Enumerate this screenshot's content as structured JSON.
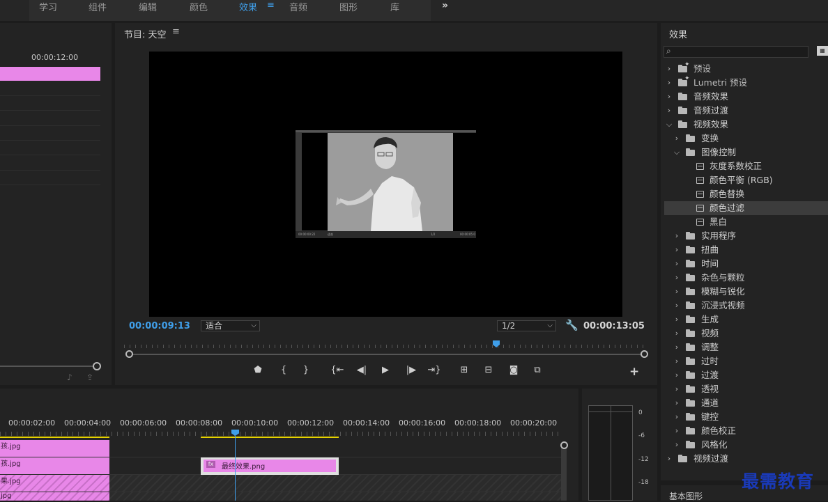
{
  "workspace_tabs": {
    "items": [
      {
        "label": "学习"
      },
      {
        "label": "组件"
      },
      {
        "label": "编辑"
      },
      {
        "label": "颜色"
      },
      {
        "label": "效果"
      },
      {
        "label": "音频"
      },
      {
        "label": "图形"
      },
      {
        "label": "库"
      }
    ],
    "active": "效果",
    "more_label": "»"
  },
  "left_panel": {
    "timecode": "00:00:12:00"
  },
  "program_monitor": {
    "title": "节目: 天空",
    "menu_icon": "≡",
    "current_timecode": "00:00:09:13",
    "fit_value": "适合",
    "resolution_value": "1/2",
    "duration": "00:00:13:05",
    "inner_thumb": {
      "left_time": "00:00:00:22",
      "fit": "适合",
      "res": "1/2",
      "right_time": "00:00:05:0"
    }
  },
  "effects_panel": {
    "title": "效果",
    "items": [
      {
        "label": "预设",
        "level": 0,
        "expanded": false,
        "type": "preset-folder"
      },
      {
        "label": "Lumetri 预设",
        "level": 0,
        "expanded": false,
        "type": "preset-folder"
      },
      {
        "label": "音频效果",
        "level": 0,
        "expanded": false,
        "type": "folder"
      },
      {
        "label": "音频过渡",
        "level": 0,
        "expanded": false,
        "type": "folder"
      },
      {
        "label": "视频效果",
        "level": 0,
        "expanded": true,
        "type": "folder"
      },
      {
        "label": "变换",
        "level": 1,
        "expanded": false,
        "type": "folder"
      },
      {
        "label": "图像控制",
        "level": 1,
        "expanded": true,
        "type": "folder"
      },
      {
        "label": "灰度系数校正",
        "level": 2,
        "type": "effect"
      },
      {
        "label": "颜色平衡 (RGB)",
        "level": 2,
        "type": "effect"
      },
      {
        "label": "颜色替换",
        "level": 2,
        "type": "effect"
      },
      {
        "label": "颜色过滤",
        "level": 2,
        "type": "effect",
        "selected": true
      },
      {
        "label": "黑白",
        "level": 2,
        "type": "effect"
      },
      {
        "label": "实用程序",
        "level": 1,
        "expanded": false,
        "type": "folder"
      },
      {
        "label": "扭曲",
        "level": 1,
        "expanded": false,
        "type": "folder"
      },
      {
        "label": "时间",
        "level": 1,
        "expanded": false,
        "type": "folder"
      },
      {
        "label": "杂色与颗粒",
        "level": 1,
        "expanded": false,
        "type": "folder"
      },
      {
        "label": "模糊与锐化",
        "level": 1,
        "expanded": false,
        "type": "folder"
      },
      {
        "label": "沉浸式视频",
        "level": 1,
        "expanded": false,
        "type": "folder"
      },
      {
        "label": "生成",
        "level": 1,
        "expanded": false,
        "type": "folder"
      },
      {
        "label": "视频",
        "level": 1,
        "expanded": false,
        "type": "folder"
      },
      {
        "label": "调整",
        "level": 1,
        "expanded": false,
        "type": "folder"
      },
      {
        "label": "过时",
        "level": 1,
        "expanded": false,
        "type": "folder"
      },
      {
        "label": "过渡",
        "level": 1,
        "expanded": false,
        "type": "folder"
      },
      {
        "label": "透视",
        "level": 1,
        "expanded": false,
        "type": "folder"
      },
      {
        "label": "通道",
        "level": 1,
        "expanded": false,
        "type": "folder"
      },
      {
        "label": "键控",
        "level": 1,
        "expanded": false,
        "type": "folder"
      },
      {
        "label": "颜色校正",
        "level": 1,
        "expanded": false,
        "type": "folder"
      },
      {
        "label": "风格化",
        "level": 1,
        "expanded": false,
        "type": "folder"
      },
      {
        "label": "视频过渡",
        "level": 0,
        "expanded": false,
        "type": "folder"
      }
    ]
  },
  "basic_graphics": {
    "title": "基本图形"
  },
  "watermark": "最需教育",
  "timeline": {
    "ruler_ticks": [
      "00:00:02:00",
      "00:00:04:00",
      "00:00:06:00",
      "00:00:08:00",
      "00:00:10:00",
      "00:00:12:00",
      "00:00:14:00",
      "00:00:16:00",
      "00:00:18:00",
      "00:00:20:00"
    ],
    "clips": [
      {
        "label": "孩.jpg"
      },
      {
        "label": "孩.jpg"
      },
      {
        "label": "果.jpg"
      },
      {
        "label": "jpg"
      }
    ],
    "selected_clip": {
      "label": "最终效果.png",
      "fx": "fx"
    }
  },
  "audio_meter": {
    "labels": [
      "0",
      "-6",
      "-12",
      "-18"
    ]
  }
}
